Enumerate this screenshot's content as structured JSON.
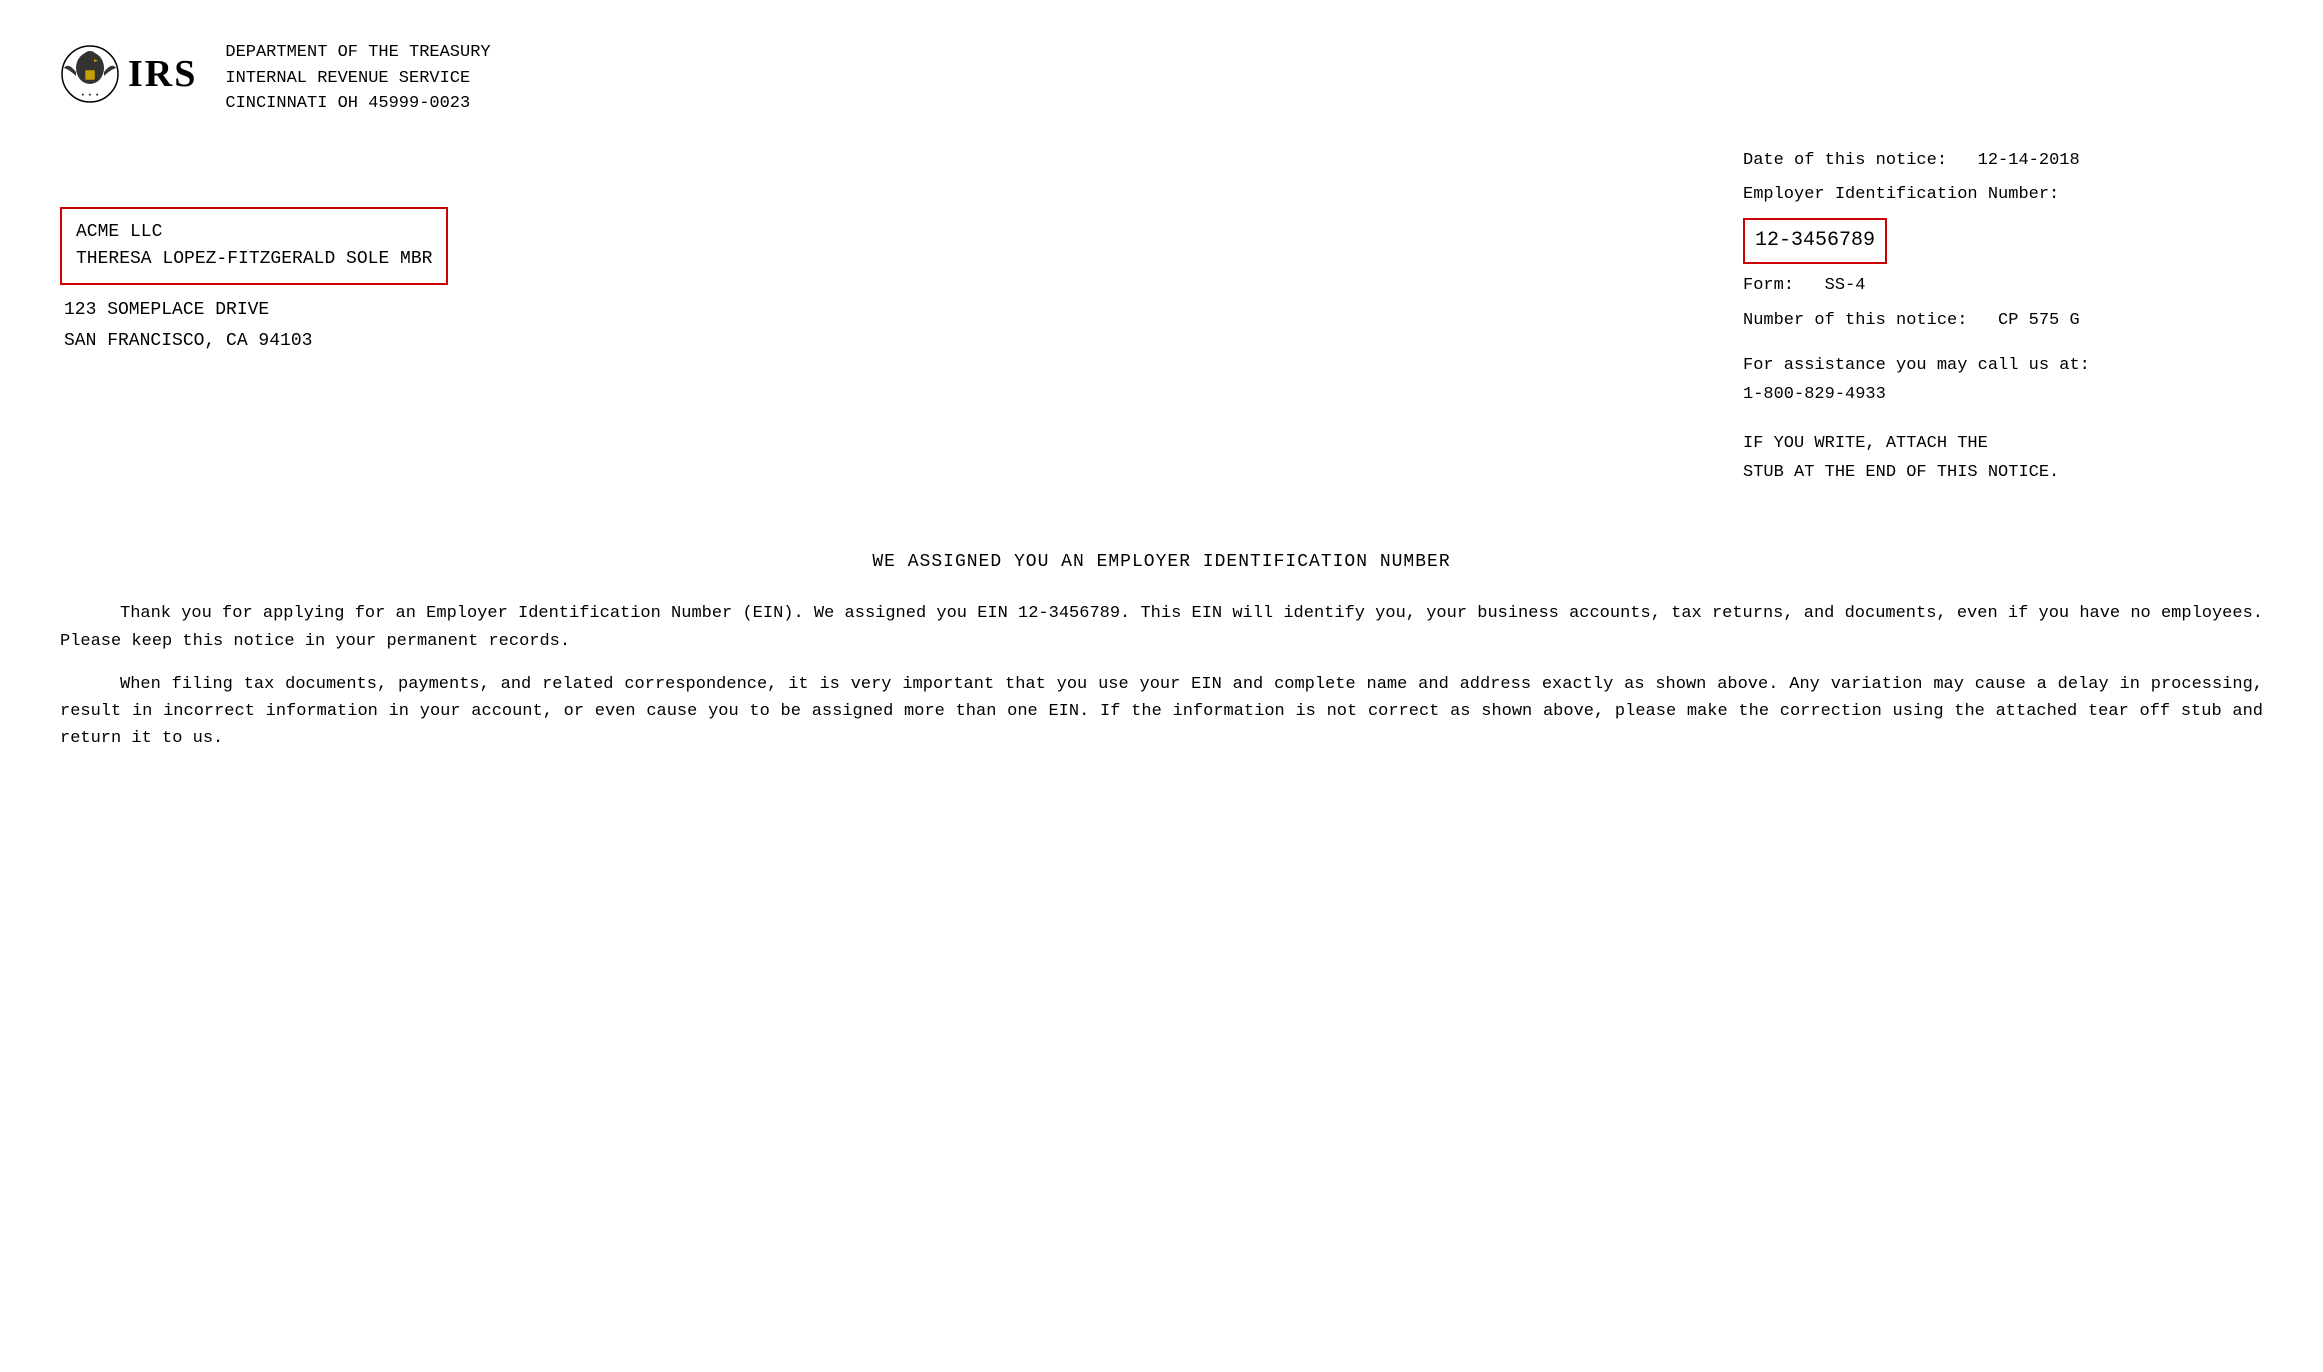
{
  "header": {
    "irs_label": "IRS",
    "agency_line1": "DEPARTMENT OF THE TREASURY",
    "agency_line2": "INTERNAL REVENUE SERVICE",
    "agency_line3": "CINCINNATI   OH   45999-0023"
  },
  "notice_info": {
    "date_label": "Date of this notice:",
    "date_value": "12-14-2018",
    "ein_label": "Employer Identification Number:",
    "ein_value": "12-3456789",
    "form_label": "Form:",
    "form_value": "SS-4",
    "notice_number_label": "Number of this notice:",
    "notice_number_value": "CP 575 G",
    "assistance_line1": "For assistance you may call us at:",
    "assistance_line2": "1-800-829-4933",
    "if_you_write_line1": "IF YOU WRITE, ATTACH THE",
    "if_you_write_line2": "STUB AT THE END OF THIS NOTICE."
  },
  "address": {
    "name_line1": "ACME LLC",
    "name_line2": "THERESA LOPEZ-FITZGERALD SOLE MBR",
    "street": "123 SOMEPLACE DRIVE",
    "city_state_zip": "SAN FRANCISCO, CA      94103"
  },
  "body": {
    "title": "WE ASSIGNED YOU AN EMPLOYER IDENTIFICATION NUMBER",
    "paragraph1": "Thank you for applying for an Employer Identification Number (EIN).  We assigned you EIN 12-3456789.  This EIN will identify you, your business accounts, tax returns, and documents, even if you have no employees.  Please keep this notice in your permanent records.",
    "paragraph2": "When filing tax documents, payments, and related correspondence, it is very important that you use your EIN and complete name and address exactly as shown above.  Any variation may cause a delay in processing, result in incorrect information in your account, or even cause you to be assigned more than one EIN.  If the information is not correct as shown above, please make the correction using the attached tear off stub and return it to us."
  }
}
